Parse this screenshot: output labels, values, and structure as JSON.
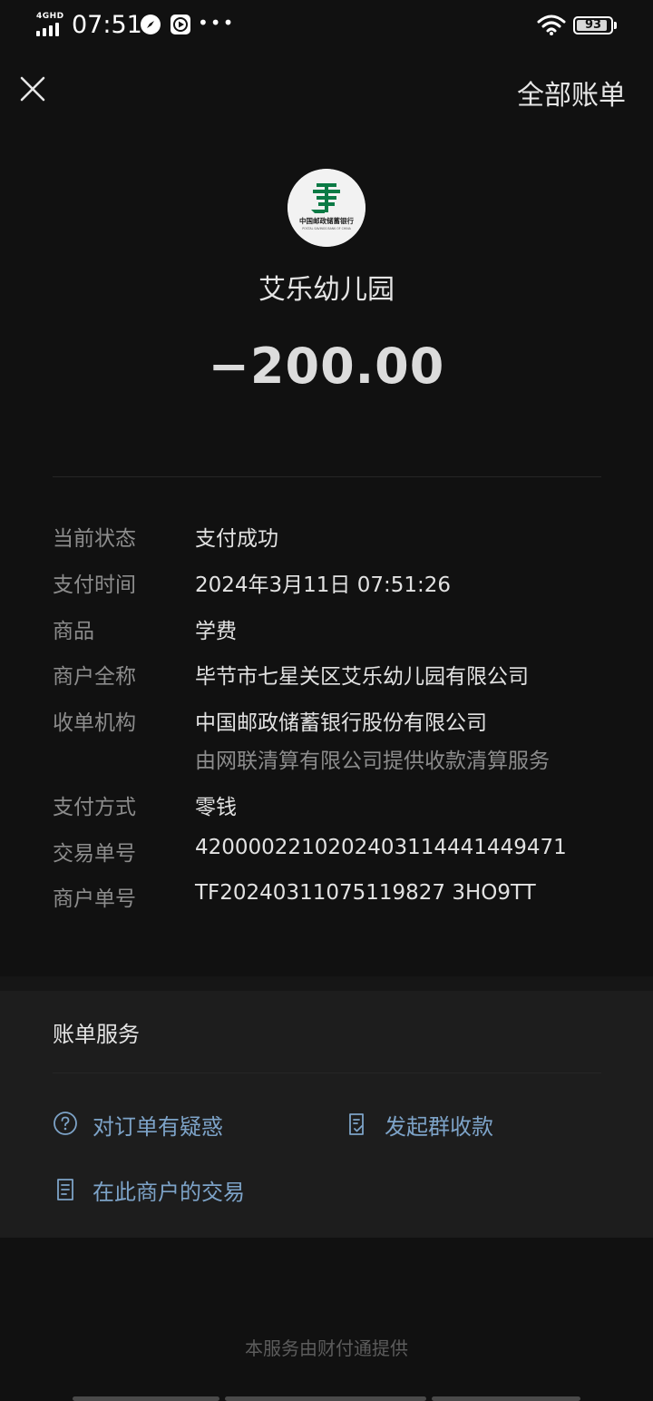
{
  "status_bar": {
    "network": "4GHD",
    "time": "07:51",
    "battery": "93",
    "battery_level": 0.93
  },
  "header": {
    "all_bills_label": "全部账单"
  },
  "merchant": {
    "name": "艾乐幼儿园",
    "amount": "−200.00",
    "logo_brand": "中国邮政储蓄银行",
    "logo_brand_en": "POSTAL SAVINGS BANK OF CHINA",
    "logo_color": "#0b7a45"
  },
  "details": [
    {
      "label": "当前状态",
      "value": "支付成功"
    },
    {
      "label": "支付时间",
      "value": "2024年3月11日 07:51:26"
    },
    {
      "label": "商品",
      "value": "学费"
    },
    {
      "label": "商户全称",
      "value": "毕节市七星关区艾乐幼儿园有限公司"
    },
    {
      "label": "收单机构",
      "value": "中国邮政储蓄银行股份有限公司",
      "sub": "由网联清算有限公司提供收款清算服务"
    },
    {
      "label": "支付方式",
      "value": "零钱"
    },
    {
      "label": "交易单号",
      "value": "4200002210202403114441449471"
    },
    {
      "label": "商户单号",
      "value": "TF20240311075119827 3HO9TT"
    }
  ],
  "services": {
    "title": "账单服务",
    "items": [
      {
        "label": "对订单有疑惑",
        "icon": "question-circle-icon"
      },
      {
        "label": "发起群收款",
        "icon": "group-collect-icon"
      },
      {
        "label": "在此商户的交易",
        "icon": "document-list-icon"
      }
    ]
  },
  "footer": {
    "text": "本服务由财付通提供"
  },
  "colors": {
    "background": "#111111",
    "link": "#7da3c8"
  }
}
